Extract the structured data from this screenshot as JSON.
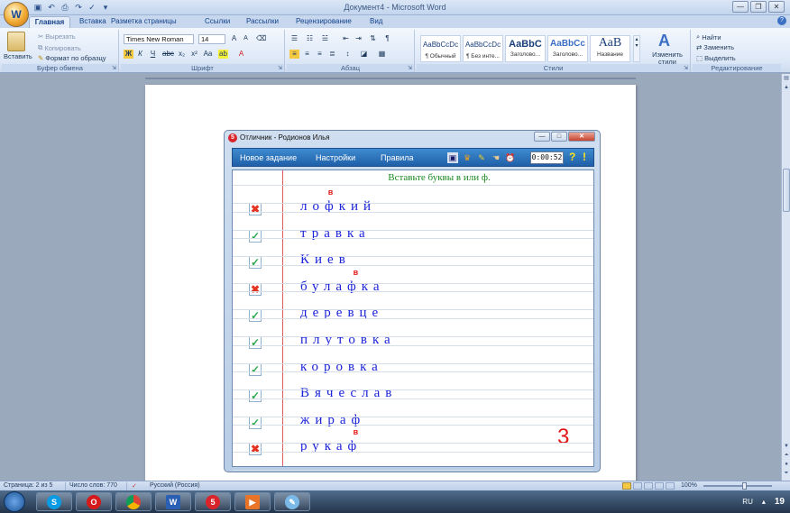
{
  "window": {
    "title": "Документ4 - Microsoft Word",
    "office_button": "W"
  },
  "tabs": [
    "Главная",
    "Вставка",
    "Разметка страницы",
    "Ссылки",
    "Рассылки",
    "Рецензирование",
    "Вид"
  ],
  "active_tab": "Главная",
  "ribbon": {
    "clipboard": {
      "label": "Буфер обмена",
      "paste": "Вставить",
      "cut": "Вырезать",
      "copy": "Копировать",
      "format_painter": "Формат по образцу"
    },
    "font": {
      "label": "Шрифт",
      "font_name": "Times New Roman",
      "font_size": "14"
    },
    "paragraph": {
      "label": "Абзац"
    },
    "styles": {
      "label": "Стили",
      "items": [
        {
          "sample": "AaBbCcDc",
          "name": "¶ Обычный"
        },
        {
          "sample": "AaBbCcDc",
          "name": "¶ Без инте..."
        },
        {
          "sample": "AaBbC",
          "name": "Заголово..."
        },
        {
          "sample": "AaBbCc",
          "name": "Заголово..."
        },
        {
          "sample": "АаВ",
          "name": "Название"
        }
      ],
      "change_styles": "Изменить стили"
    },
    "editing": {
      "label": "Редактирование",
      "find": "Найти",
      "replace": "Заменить",
      "select": "Выделить"
    }
  },
  "app": {
    "title": "Отличник - Родионов Илья",
    "icon_text": "5",
    "menu": [
      "Новое задание",
      "Настройки",
      "Правила"
    ],
    "timer": "0:00:52",
    "instruction": "Вставьте буквы в или ф.",
    "rows": [
      {
        "word": "лофкий",
        "status": "wrong",
        "correction": "в"
      },
      {
        "word": "травка",
        "status": "correct",
        "correction": ""
      },
      {
        "word": "Киев",
        "status": "correct",
        "correction": ""
      },
      {
        "word": "булафка",
        "status": "wrong",
        "correction": "в"
      },
      {
        "word": "деревце",
        "status": "correct",
        "correction": ""
      },
      {
        "word": "плутовка",
        "status": "correct",
        "correction": ""
      },
      {
        "word": "коровка",
        "status": "correct",
        "correction": ""
      },
      {
        "word": "Вячеслав",
        "status": "correct",
        "correction": ""
      },
      {
        "word": "жираф",
        "status": "correct",
        "correction": ""
      },
      {
        "word": "рукаф",
        "status": "wrong",
        "correction": "в"
      }
    ],
    "score": "3"
  },
  "status_bar": {
    "page": "Страница: 2 из 5",
    "words": "Число слов: 770",
    "language": "Русский (Россия)",
    "zoom": "100%"
  },
  "taskbar": {
    "tray_lang": "RU",
    "tray_time": "19"
  },
  "colors": {
    "app_menu_bar": "#2a6fbb",
    "word_text": "#1a23d8",
    "instruction_text": "#1c8a22",
    "correction_mark": "#e01818",
    "check_green": "#2ea84f",
    "cross_red": "#e53322"
  }
}
